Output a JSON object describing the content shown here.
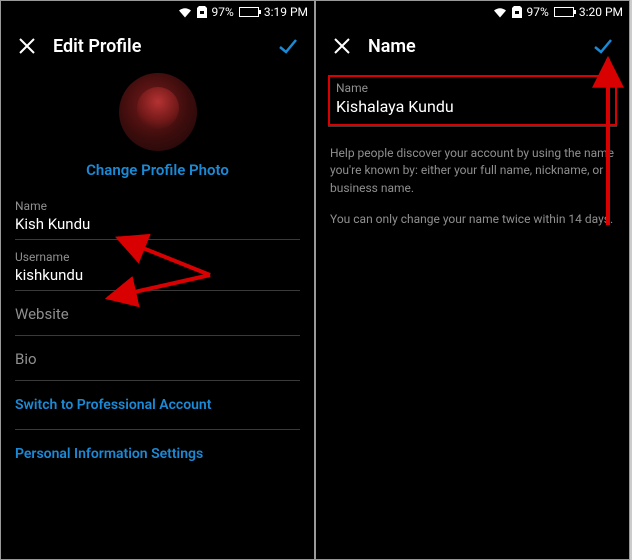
{
  "left": {
    "status": {
      "battery": "97%",
      "time": "3:19 PM"
    },
    "header": {
      "title": "Edit Profile"
    },
    "changePhoto": "Change Profile Photo",
    "fields": {
      "name": {
        "label": "Name",
        "value": "Kish Kundu"
      },
      "username": {
        "label": "Username",
        "value": "kishkundu"
      },
      "website": {
        "placeholder": "Website"
      },
      "bio": {
        "placeholder": "Bio"
      }
    },
    "links": {
      "switchPro": "Switch to Professional Account",
      "personalInfo": "Personal Information Settings"
    }
  },
  "right": {
    "status": {
      "battery": "97%",
      "time": "3:20 PM"
    },
    "header": {
      "title": "Name"
    },
    "field": {
      "label": "Name",
      "value": "Kishalaya Kundu"
    },
    "help1": "Help people discover your account by using the name you're known by: either your full name, nickname, or business name.",
    "help2": "You can only change your name twice within 14 days."
  }
}
